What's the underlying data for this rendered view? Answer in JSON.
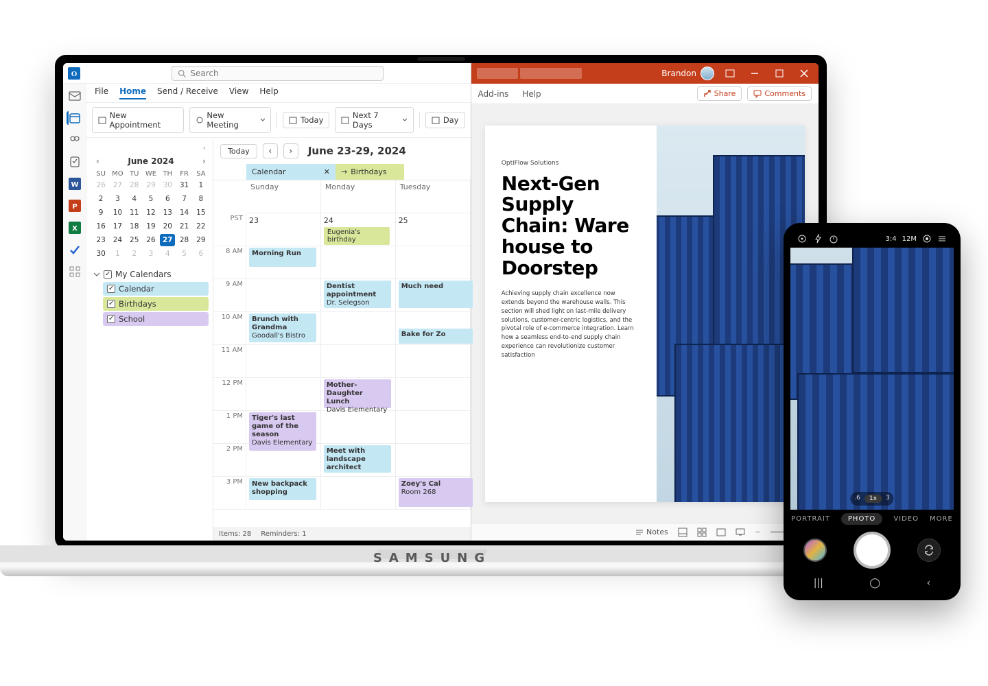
{
  "laptop_brand": "SAMSUNG",
  "outlook": {
    "search_placeholder": "Search",
    "menus": {
      "file": "File",
      "home": "Home",
      "send_receive": "Send / Receive",
      "view": "View",
      "help": "Help"
    },
    "actions": {
      "new_appointment": "New Appointment",
      "new_meeting": "New Meeting",
      "today": "Today",
      "next7": "Next 7 Days",
      "day": "Day"
    },
    "mini_calendar": {
      "title": "June 2024",
      "dows": [
        "SU",
        "MO",
        "TU",
        "WE",
        "TH",
        "FR",
        "SA"
      ],
      "rows": [
        [
          "26",
          "27",
          "28",
          "29",
          "30",
          "31",
          "1"
        ],
        [
          "2",
          "3",
          "4",
          "5",
          "6",
          "7",
          "8"
        ],
        [
          "9",
          "10",
          "11",
          "12",
          "13",
          "14",
          "15"
        ],
        [
          "16",
          "17",
          "18",
          "19",
          "20",
          "21",
          "22"
        ],
        [
          "23",
          "24",
          "25",
          "26",
          "27",
          "28",
          "29"
        ],
        [
          "30",
          "1",
          "2",
          "3",
          "4",
          "5",
          "6"
        ]
      ],
      "muted_first_count": 5,
      "muted_last_row": true,
      "today_value": "27"
    },
    "tree_header": "My Calendars",
    "calendars": {
      "calendar": "Calendar",
      "birthdays": "Birthdays",
      "school": "School"
    },
    "week": {
      "today_btn": "Today",
      "range": "June  23-29, 2024",
      "tabs": {
        "calendar": "Calendar",
        "birthdays": "Birthdays"
      },
      "tz": "PST",
      "days": {
        "sun": "Sunday",
        "mon": "Monday",
        "tue": "Tuesday"
      },
      "dates": {
        "sun": "23",
        "mon": "24",
        "tue": "25"
      },
      "allday": {
        "mon": "Eugenia's birthday"
      },
      "times": [
        "8 AM",
        "9 AM",
        "10 AM",
        "11 AM",
        "12 PM",
        "1 PM",
        "2 PM",
        "3 PM"
      ],
      "events": {
        "morning_run": {
          "title": "Morning Run"
        },
        "dentist": {
          "title": "Dentist appointment",
          "sub": "Dr. Selegson"
        },
        "much_need": {
          "title": "Much need"
        },
        "brunch": {
          "title": "Brunch with Grandma",
          "sub": "Goodall's Bistro"
        },
        "bake": {
          "title": "Bake for Zo"
        },
        "lunch": {
          "title": "Mother-Daughter Lunch",
          "sub": "Davis Elementary"
        },
        "tiger": {
          "title": "Tiger's last game of the season",
          "sub": "Davis Elementary"
        },
        "landscape": {
          "title": "Meet with landscape architect"
        },
        "backpack": {
          "title": "New backpack shopping"
        },
        "zoey": {
          "title": "Zoey's Cal",
          "sub": "Room 268"
        }
      }
    },
    "status": {
      "items": "Items:  28",
      "reminders": "Reminders: 1"
    }
  },
  "ppt": {
    "user": "Brandon",
    "ribbon": {
      "addins": "Add-ins",
      "help": "Help",
      "share": "Share",
      "comments": "Comments"
    },
    "slide": {
      "pretitle": "OptiFlow Solutions",
      "title": "Next-Gen Supply Chain: Ware house to Doorstep",
      "body": "Achieving supply chain excellence now extends beyond the warehouse walls. This section will shed light on last-mile delivery solutions, customer-centric logistics, and the pivotal role of e-commerce integration. Learn how a seamless end-to-end supply chain experience can revolutionize customer satisfaction"
    },
    "status": {
      "notes": "Notes"
    }
  },
  "phone": {
    "top": {
      "ratio": "3:4",
      "mp": "12M"
    },
    "zoom": {
      "a": ".6",
      "b": "1x",
      "c": "3"
    },
    "modes": {
      "portrait": "PORTRAIT",
      "photo": "PHOTO",
      "video": "VIDEO",
      "more": "MORE"
    }
  }
}
